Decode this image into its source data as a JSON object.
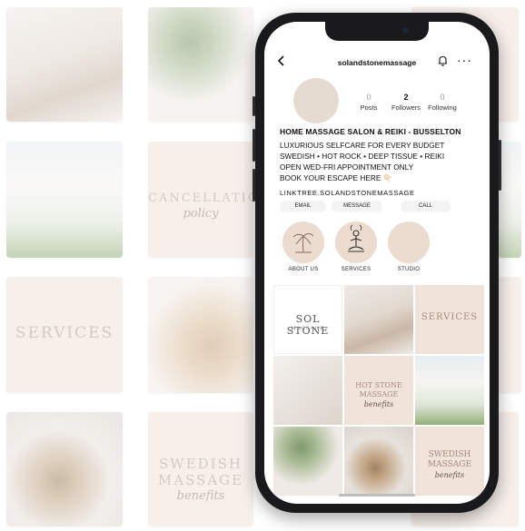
{
  "background": {
    "tiles": {
      "cancellation_title": "CANCELLATION",
      "cancellation_script": "policy",
      "services_title": "SERVICES",
      "swedish_title_1": "SWEDISH",
      "swedish_title_2": "MASSAGE",
      "swedish_script": "benefits"
    }
  },
  "profile": {
    "username": "solandstonemassage",
    "stats": [
      {
        "value": "0",
        "label": "Posts"
      },
      {
        "value": "2",
        "label": "Followers"
      },
      {
        "value": "0",
        "label": "Following"
      }
    ],
    "name": "HOME MASSAGE SALON & REIKI - BUSSELTON",
    "bio_lines": [
      "LUXURIOUS SELFCARE FOR EVERY BUDGET",
      "SWEDISH • HOT ROCK • DEEP TISSUE • REIKI",
      "OPEN WED-FRI  APPOINTMENT ONLY",
      "BOOK YOUR ESCAPE HERE 👇🏻"
    ],
    "link": "LINKTREE.SOLANDSTONEMASSAGE",
    "actions": [
      "EMAIL",
      "MESSAGE",
      "CALL"
    ],
    "highlights": [
      "ABOUT US",
      "SERVICES",
      "STUDIO"
    ]
  },
  "posts": {
    "logo_text": "SOL STONE",
    "logo_sub": "MASSAGE",
    "services_title": "SERVICES",
    "hot_stone_1": "HOT STONE",
    "hot_stone_2": "MASSAGE",
    "hot_stone_script": "benefits",
    "swedish_1": "SWEDISH",
    "swedish_2": "MASSAGE",
    "swedish_script": "benefits"
  },
  "colors": {
    "accent_beige": "#ecdccf",
    "text": "#111111",
    "phone_frame": "#1a1a1c"
  }
}
